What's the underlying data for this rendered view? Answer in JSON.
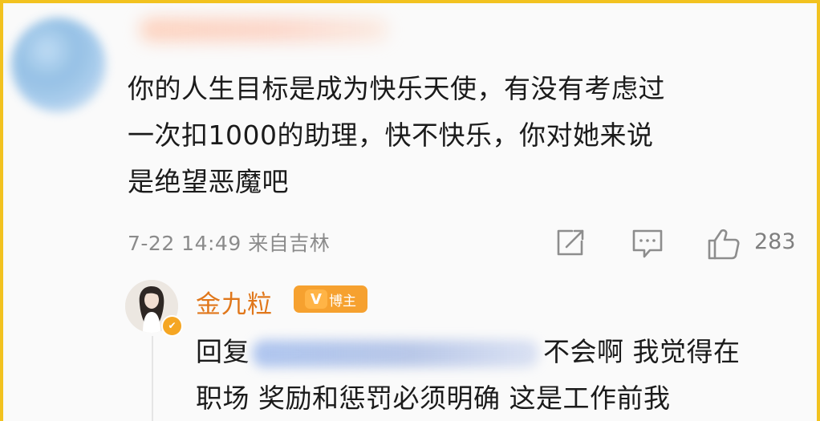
{
  "comment": {
    "lines": [
      "你的人生目标是成为快乐天使，有没有考虑过",
      "一次扣1000的助理，快不快乐，你对她来说",
      "是绝望恶魔吧"
    ],
    "timestamp": "7-22 14:49",
    "location": "来自吉林",
    "like_count": "283"
  },
  "reply": {
    "author_name": "金九粒",
    "author_badge": "博主",
    "badge_icon_label": "V",
    "prefix": "回复",
    "line1_after_mention": "不会啊 我觉得在",
    "line2": "职场 奖励和惩罚必须明确 这是工作前我"
  },
  "colors": {
    "frame_border": "#f2c21f",
    "author_name": "#e0771b",
    "badge": "#f6a12f",
    "meta_text": "#8b8b8b"
  },
  "icons": {
    "share": "share-icon",
    "comment": "comment-icon",
    "like": "thumbs-up-icon",
    "verified": "verified-badge-icon"
  }
}
